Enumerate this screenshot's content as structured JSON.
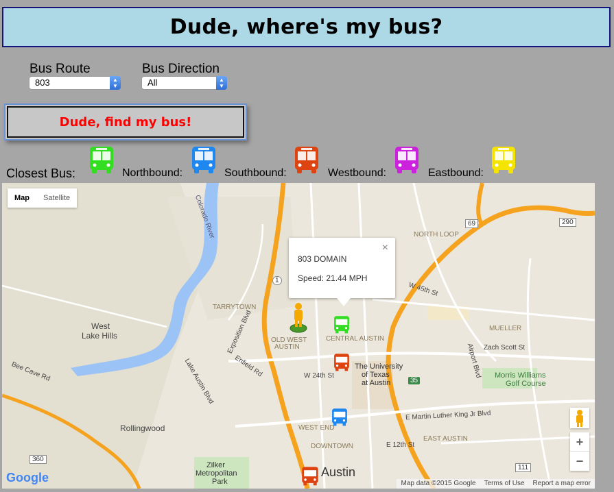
{
  "header": {
    "title": "Dude, where's my bus?"
  },
  "controls": {
    "route_label": "Bus Route",
    "route_value": "803",
    "direction_label": "Bus Direction",
    "direction_value": "All",
    "find_button": "Dude, find my bus!"
  },
  "legend": {
    "closest": "Closest Bus:",
    "northbound": "Northbound:",
    "southbound": "Southbound:",
    "westbound": "Westbound:",
    "eastbound": "Eastbound:",
    "colors": {
      "closest": "#33dd22",
      "northbound": "#1e88f0",
      "southbound": "#dd4411",
      "westbound": "#cc22dd",
      "eastbound": "#f5e400"
    }
  },
  "map": {
    "type_map": "Map",
    "type_satellite": "Satellite",
    "popup": {
      "name": "803 DOMAIN",
      "speed": "Speed: 21.44 MPH"
    },
    "zoom_in": "+",
    "zoom_out": "−",
    "attribution": {
      "data": "Map data ©2015 Google",
      "terms": "Terms of Use",
      "report": "Report a map error"
    },
    "google": "Google",
    "labels": {
      "tarrytown": "TARRYTOWN",
      "west_lake_hills_1": "West",
      "west_lake_hills_2": "Lake Hills",
      "old_west_austin_1": "OLD WEST",
      "old_west_austin_2": "AUSTIN",
      "central_austin": "CENTRAL AUSTIN",
      "north_loop": "NORTH LOOP",
      "mueller": "MUELLER",
      "ut_1": "The University",
      "ut_2": "of Texas",
      "ut_3": "at Austin",
      "w24": "W 24th St",
      "west_end": "WEST END",
      "downtown": "DOWNTOWN",
      "east_austin": "EAST AUSTIN",
      "austin": "Austin",
      "rollingwood": "Rollingwood",
      "zilker_1": "Zilker",
      "zilker_2": "Metropolitan",
      "zilker_3": "Park",
      "morris_1": "Morris Williams",
      "morris_2": "Golf Course",
      "zach_scott": "Zach Scott St",
      "w45": "W 45th St",
      "bee_cave": "Bee Cave Rd",
      "exposition": "Exposition Blvd",
      "enfield": "Enfield Rd",
      "lake_austin": "Lake Austin Blvd",
      "mlk": "E Martin Luther King Jr Blvd",
      "e12": "E 12th St",
      "airport": "Airport Blvd",
      "colorado": "Colorado River",
      "hwy_35": "35",
      "hwy_69": "69",
      "hwy_290": "290",
      "hwy_1": "1",
      "hwy_360": "360",
      "hwy_111": "111"
    }
  }
}
